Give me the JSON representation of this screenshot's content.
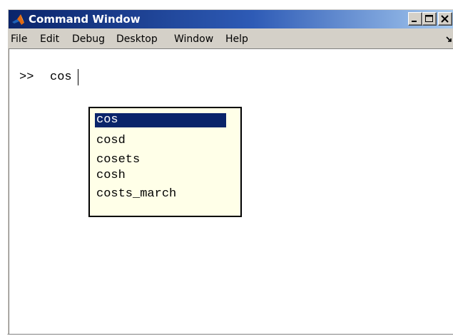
{
  "window": {
    "title": "Command Window",
    "controls": [
      "minimize-icon",
      "maximize-icon",
      "close-icon"
    ],
    "colors": {
      "titlebar_start": "#0a246a",
      "titlebar_end": "#a6caf0",
      "face": "#d4d0c8"
    }
  },
  "menu": {
    "items": [
      "File",
      "Edit",
      "Debug",
      "Desktop",
      "Window",
      "Help"
    ],
    "overflow_icon": "menu-overflow-arrow-icon"
  },
  "console": {
    "prompt": ">>",
    "input": "cos"
  },
  "completion": {
    "options": [
      "cos",
      "cosd",
      "cosets",
      "cosh",
      "costs_march"
    ],
    "selected": "cos",
    "colors": {
      "background": "#ffffe8",
      "selection": "#0a246a"
    }
  }
}
